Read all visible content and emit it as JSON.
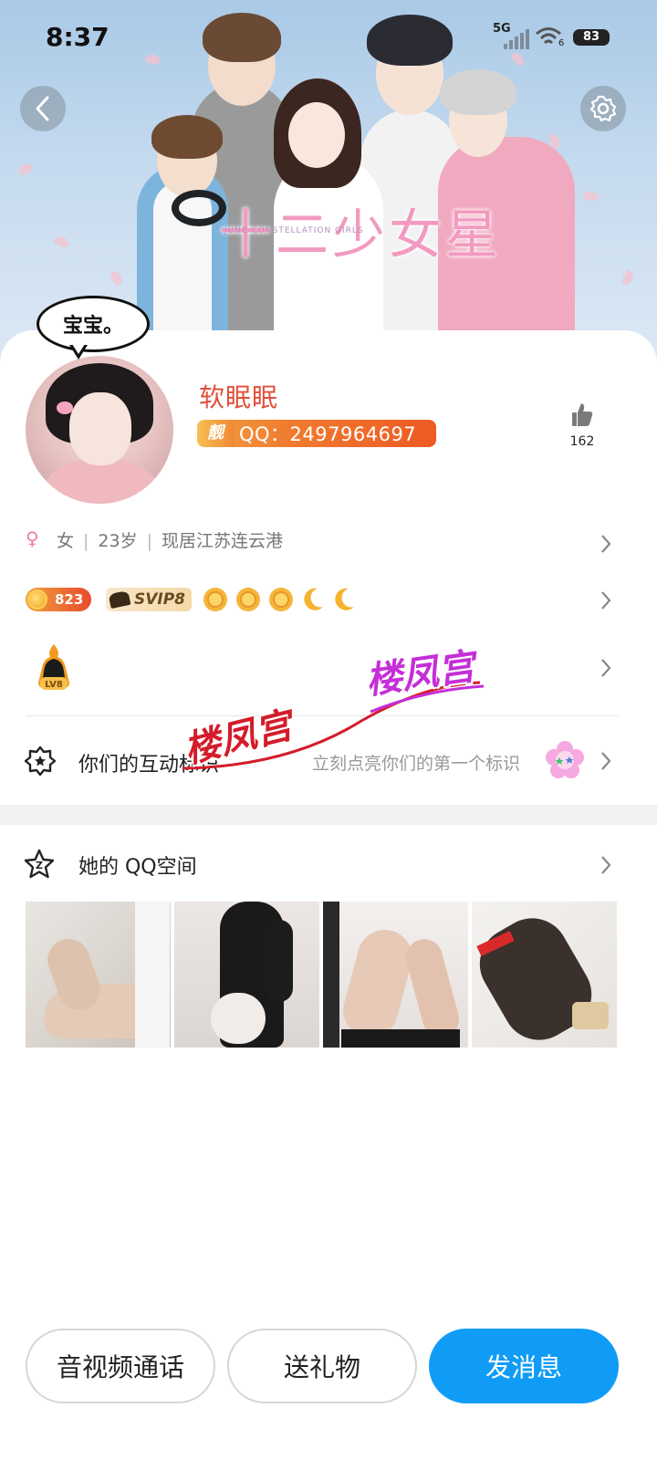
{
  "status_bar": {
    "time": "8:37",
    "network": "5G",
    "wifi_label": "6",
    "battery": "83"
  },
  "header": {
    "background_title": "十二少女星",
    "background_subtitle": "JUNE CONSTELLATION GIRLS",
    "back_icon": "chevron-left-icon",
    "settings_icon": "gear-icon"
  },
  "profile": {
    "bubble_text": "宝宝。",
    "nickname": "软眠眠",
    "liang_label": "靓",
    "qq_number": "QQ：2497964697",
    "like_count": "162",
    "gender_symbol": "♀",
    "gender": "女",
    "age": "23岁",
    "location": "现居江苏连云港"
  },
  "badges": {
    "coin_count": "823",
    "svip": "SVIP8",
    "suns": 3,
    "moons": 2,
    "level_label": "LV8"
  },
  "interaction": {
    "title": "你们的互动标识",
    "hint": "立刻点亮你们的第一个标识"
  },
  "watermark": {
    "text_red": "楼凤宫",
    "text_purple": "楼凤宫"
  },
  "qzone": {
    "title": "她的 QQ空间",
    "photo_count": 4
  },
  "actions": {
    "call": "音视频通话",
    "gift": "送礼物",
    "message": "发消息"
  },
  "colors": {
    "accent_blue": "#109cf6",
    "nickname_red": "#e0503a",
    "badge_orange": "#ee5a24",
    "gender_pink": "#f07aa0"
  }
}
